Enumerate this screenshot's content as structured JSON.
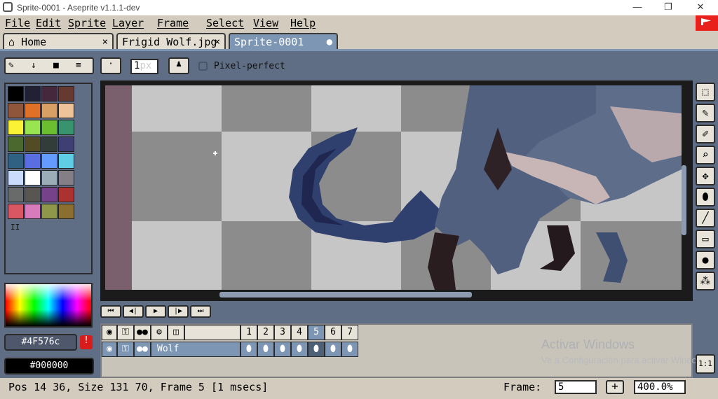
{
  "window": {
    "title": "Sprite-0001 - Aseprite v1.1.1-dev",
    "minimize": "—",
    "maximize": "❐",
    "close": "✕"
  },
  "menu": [
    "File",
    "Edit",
    "Sprite",
    "Layer",
    "Frame",
    "Select",
    "View",
    "Help"
  ],
  "tabs": [
    {
      "label": "Home",
      "icon": "home-icon",
      "close": "×"
    },
    {
      "label": "Frigid Wolf.jpg",
      "close": "×"
    },
    {
      "label": "Sprite-0001",
      "modified": "●"
    }
  ],
  "toolbar": {
    "icons": [
      "eraser-icon",
      "download-icon",
      "folder-icon",
      "menu-icon"
    ],
    "brush_size_value": "1",
    "brush_size_unit": "px",
    "pixel_perfect_label": "Pixel-perfect",
    "pixel_perfect_checked": false
  },
  "palette_colors": [
    "#000000",
    "#222034",
    "#45283c",
    "#663931",
    "#8f563b",
    "#df7126",
    "#d9a066",
    "#eec39a",
    "#fbf236",
    "#99e550",
    "#6abe30",
    "#37946e",
    "#4b692f",
    "#524b24",
    "#323c39",
    "#3f3f74",
    "#306082",
    "#5b6ee1",
    "#639bff",
    "#5fcde4",
    "#cbdbfc",
    "#ffffff",
    "#9badb7",
    "#847e87",
    "#696a6a",
    "#595652",
    "#76428a",
    "#ac3232",
    "#d95763",
    "#d77bba",
    "#8f974a",
    "#8a6f30"
  ],
  "palette_pause_glyph": "II",
  "colors": {
    "foreground": "#4F576c",
    "background": "#000000",
    "warning_glyph": "!"
  },
  "playback_buttons": [
    "⏮",
    "◀|",
    "▶",
    "|▶",
    "⏭"
  ],
  "timeline": {
    "header_icons": [
      "eye-icon",
      "lock-icon",
      "continuous-icon",
      "gear-icon",
      "layers-icon"
    ],
    "frames": [
      "1",
      "2",
      "3",
      "4",
      "5",
      "6",
      "7"
    ],
    "active_frame": "5",
    "layer_name": "Wolf"
  },
  "watermark": {
    "title": "Activar Windows",
    "subtitle": "Ve a Configuración para activar Windows."
  },
  "status": {
    "info": "Pos 14 36, Size 131 70, Frame 5 [1 msecs]",
    "frame_label": "Frame:",
    "frame_value": "5",
    "add_frame": "+",
    "zoom": "400.0%",
    "ratio": "1:1"
  },
  "right_tools": [
    "marquee-icon",
    "pencil-icon",
    "eyedropper-icon",
    "zoom-icon",
    "move-icon",
    "bucket-icon",
    "line-icon",
    "rectangle-icon",
    "blob-icon",
    "spray-icon"
  ]
}
